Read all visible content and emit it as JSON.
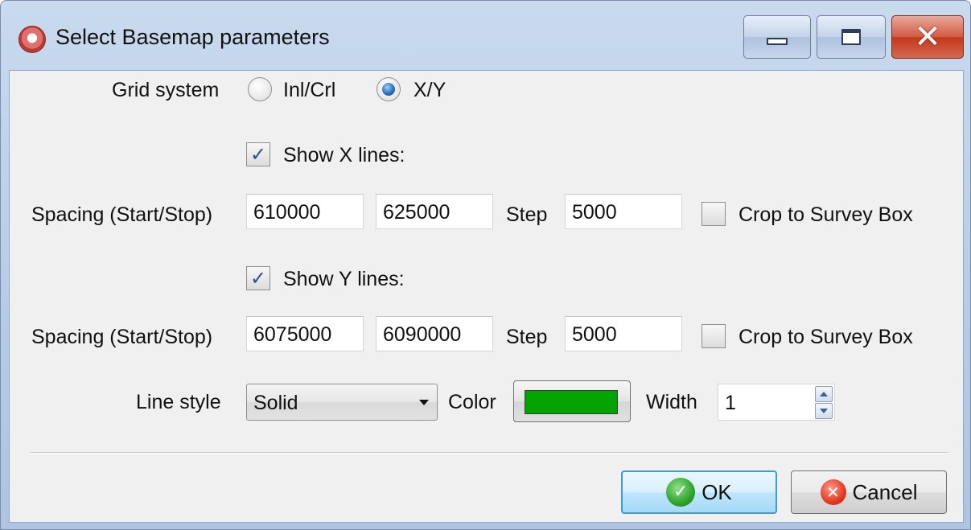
{
  "window": {
    "title": "Select Basemap parameters",
    "icon": "app-icon",
    "controls": {
      "minimize_icon": "minimize-icon",
      "maximize_icon": "maximize-icon",
      "close_glyph": "✕"
    }
  },
  "grid_system": {
    "label": "Grid system",
    "options": [
      {
        "label": "Inl/Crl",
        "selected": false
      },
      {
        "label": "X/Y",
        "selected": true
      }
    ]
  },
  "x_lines": {
    "show_label": "Show X lines:",
    "show_checked": true,
    "spacing_label": "Spacing (Start/Stop)",
    "start": "610000",
    "stop": "625000",
    "step_label": "Step",
    "step": "5000",
    "crop_label": "Crop to Survey Box",
    "crop_checked": false
  },
  "y_lines": {
    "show_label": "Show Y lines:",
    "show_checked": true,
    "spacing_label": "Spacing (Start/Stop)",
    "start": "6075000",
    "stop": "6090000",
    "step_label": "Step",
    "step": "5000",
    "crop_label": "Crop to Survey Box",
    "crop_checked": false
  },
  "style": {
    "line_style_label": "Line style",
    "line_style_value": "Solid",
    "color_label": "Color",
    "color_value": "#00a300",
    "width_label": "Width",
    "width_value": "1"
  },
  "buttons": {
    "ok_label": "OK",
    "cancel_label": "Cancel"
  },
  "checkmark": "✓"
}
